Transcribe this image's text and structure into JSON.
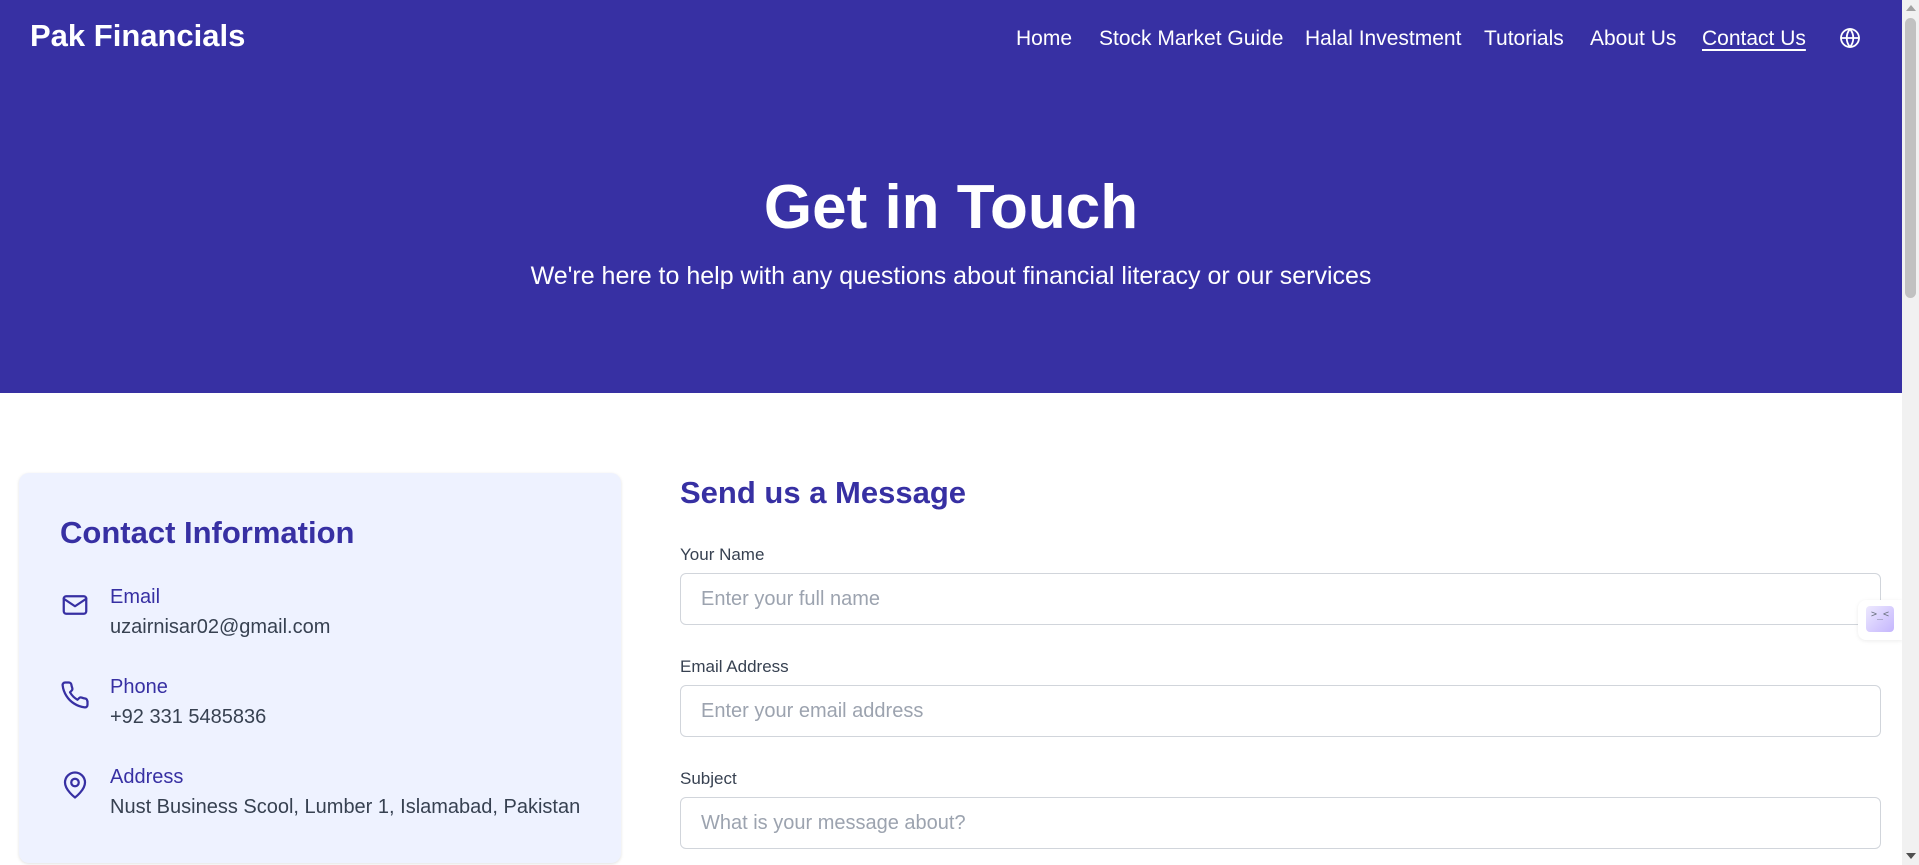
{
  "brand": "Pak Financials",
  "nav": {
    "items": [
      {
        "label": "Home"
      },
      {
        "label": "Stock Market Guide"
      },
      {
        "label": "Halal Investment"
      },
      {
        "label": "Tutorials"
      },
      {
        "label": "About Us"
      },
      {
        "label": "Contact Us",
        "active": true
      }
    ],
    "language_icon": "globe-icon"
  },
  "hero": {
    "title": "Get in Touch",
    "subtitle": "We're here to help with any questions about financial literacy or our services"
  },
  "contact_info": {
    "title": "Contact Information",
    "items": [
      {
        "icon": "mail-icon",
        "label": "Email",
        "value": "uzairnisar02@gmail.com"
      },
      {
        "icon": "phone-icon",
        "label": "Phone",
        "value": "+92 331 5485836"
      },
      {
        "icon": "map-pin-icon",
        "label": "Address",
        "value": "Nust Business Scool, Lumber 1, Islamabad, Pakistan"
      }
    ]
  },
  "form": {
    "title": "Send us a Message",
    "fields": [
      {
        "label": "Your Name",
        "value": "",
        "placeholder": "Enter your full name"
      },
      {
        "label": "Email Address",
        "value": "",
        "placeholder": "Enter your email address"
      },
      {
        "label": "Subject",
        "value": "",
        "placeholder": "What is your message about?"
      }
    ]
  },
  "side_widget": {
    "glyph": ">_<"
  },
  "colors": {
    "primary": "#3730a3",
    "card_background": "#eef2ff",
    "text": "#374151",
    "placeholder": "#9ca3af",
    "border": "#d1d5db"
  }
}
